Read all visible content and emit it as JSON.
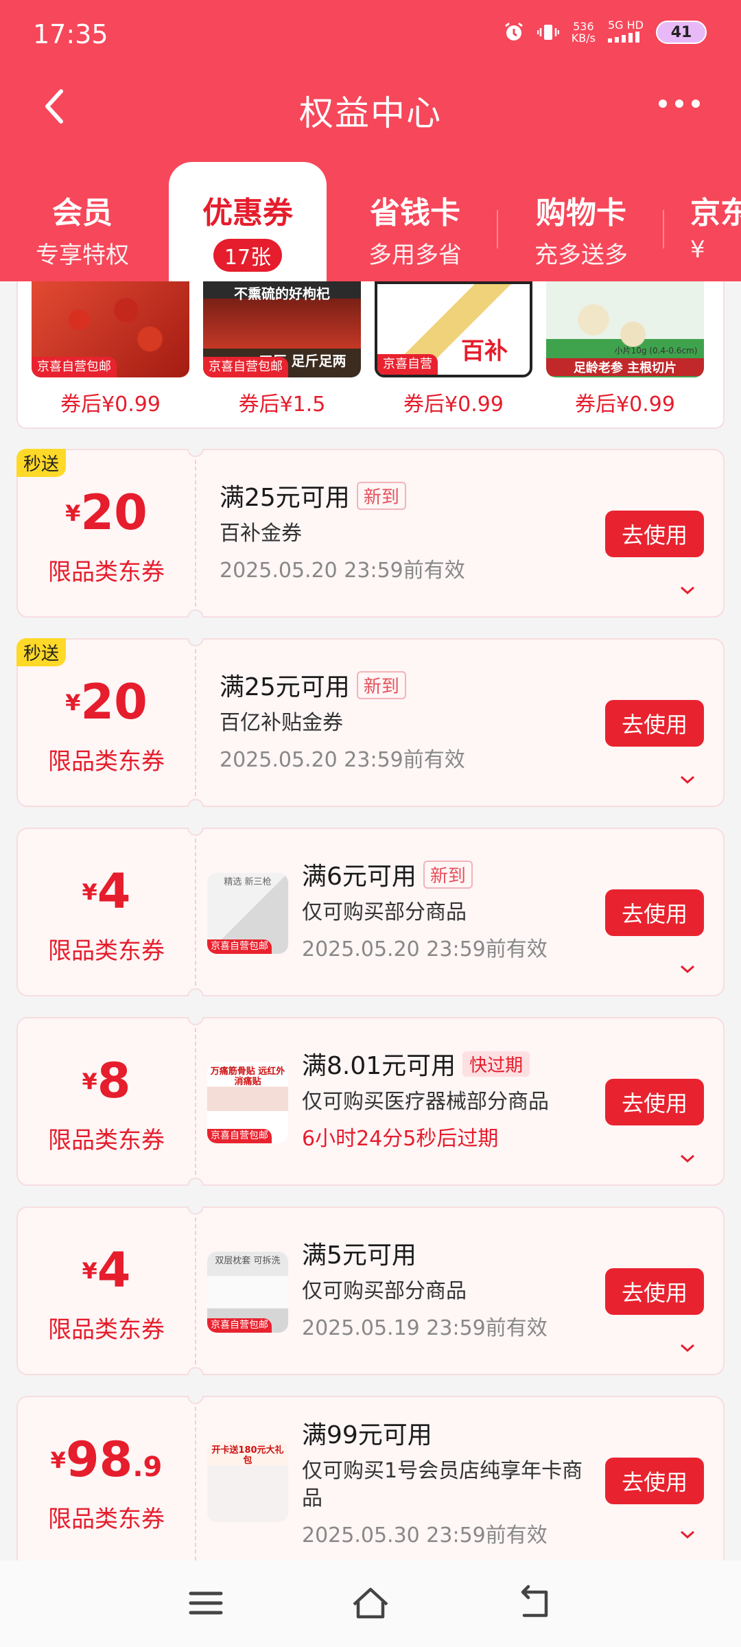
{
  "status": {
    "time": "17:35",
    "speed_top": "536",
    "speed_bottom": "KB/s",
    "net_top": "5G HD",
    "battery": "41"
  },
  "nav": {
    "title": "权益中心"
  },
  "tabs": [
    {
      "title": "会员",
      "sub": "专享特权"
    },
    {
      "title": "优惠券",
      "sub": "17张"
    },
    {
      "title": "省钱卡",
      "sub": "多用多省"
    },
    {
      "title": "购物卡",
      "sub": "充多送多"
    },
    {
      "title": "京东",
      "sub": "¥"
    }
  ],
  "products": [
    {
      "price": "券后¥0.99",
      "tag": "京喜自营包邮",
      "img_text": ""
    },
    {
      "price": "券后¥1.5",
      "tag": "京喜自营包邮",
      "img_text": "不熏硫的好枸杞",
      "img_text2": "工厂 足斤足两"
    },
    {
      "price": "券后¥0.99",
      "tag": "京喜自营",
      "img_text": "百补"
    },
    {
      "price": "券后¥0.99",
      "tag": "",
      "img_text": "足龄老参 主根切片",
      "img_text2": "小片10g (0.4-0.6cm)"
    }
  ],
  "coupons": [
    {
      "flash": "秒送",
      "yen": "¥",
      "amount": "20",
      "dec": "",
      "label": "限品类东券",
      "cond": "满25元可用",
      "tag": "新到",
      "desc": "百补金券",
      "valid": "2025.05.20 23:59前有效",
      "button": "去使用"
    },
    {
      "flash": "秒送",
      "yen": "¥",
      "amount": "20",
      "dec": "",
      "label": "限品类东券",
      "cond": "满25元可用",
      "tag": "新到",
      "desc": "百亿补贴金券",
      "valid": "2025.05.20 23:59前有效",
      "button": "去使用"
    },
    {
      "yen": "¥",
      "amount": "4",
      "dec": "",
      "label": "限品类东券",
      "cond": "满6元可用",
      "tag": "新到",
      "desc": "仅可购买部分商品",
      "valid": "2025.05.20 23:59前有效",
      "button": "去使用",
      "thumb_tag": "京喜自营包邮",
      "thumb_text": "精选 新三枪"
    },
    {
      "yen": "¥",
      "amount": "8",
      "dec": "",
      "label": "限品类东券",
      "cond": "满8.01元可用",
      "tag": "快过期",
      "desc": "仅可购买医疗器械部分商品",
      "valid": "6小时24分5秒后过期",
      "button": "去使用",
      "thumb_tag": "京喜自营包邮",
      "thumb_text": "万痛筋骨贴 远红外消痛贴"
    },
    {
      "yen": "¥",
      "amount": "4",
      "dec": "",
      "label": "限品类东券",
      "cond": "满5元可用",
      "tag": "",
      "desc": "仅可购买部分商品",
      "valid": "2025.05.19 23:59前有效",
      "button": "去使用",
      "thumb_tag": "京喜自营包邮",
      "thumb_text": "双层枕套 可拆洗"
    },
    {
      "yen": "¥",
      "amount": "98",
      "dec": ".9",
      "label": "限品类东券",
      "cond": "满99元可用",
      "tag": "",
      "desc": "仅可购买1号会员店纯享年卡商品",
      "valid": "2025.05.30 23:59前有效",
      "button": "去使用",
      "thumb_tag": "",
      "thumb_text": "开卡送180元大礼包"
    }
  ]
}
